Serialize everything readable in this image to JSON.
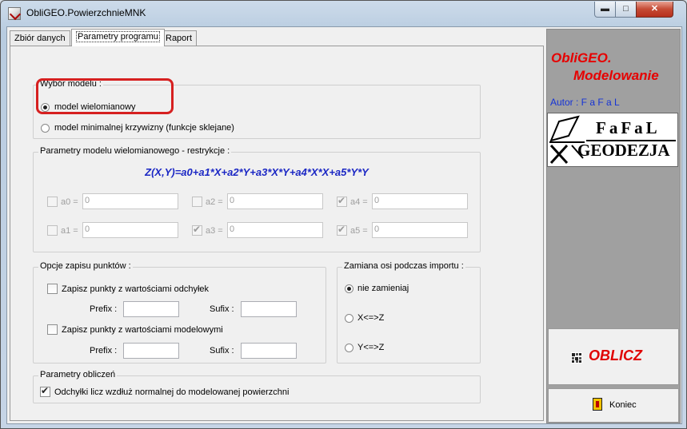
{
  "window": {
    "title": "ObliGEO.PowierzchnieMNK",
    "min_glyph": "▬",
    "max_glyph": "□",
    "close_glyph": "✕"
  },
  "tabs": [
    {
      "label": "Zbiór danych",
      "active": false
    },
    {
      "label": "Parametry programu",
      "active": true
    },
    {
      "label": "Raport",
      "active": false
    }
  ],
  "model_group": {
    "title": "Wybór modelu :",
    "options": [
      {
        "label": "model wielomianowy",
        "selected": true
      },
      {
        "label": "model minimalnej krzywizny (funkcje sklejane)",
        "selected": false
      }
    ]
  },
  "poly_group": {
    "title": "Parametry modelu wielomianowego - restrykcje :",
    "formula": "Z(X,Y)=a0+a1*X+a2*Y+a3*X*Y+a4*X*X+a5*Y*Y",
    "params": [
      {
        "label": "a0 =",
        "value": "0",
        "checked": false
      },
      {
        "label": "a2 =",
        "value": "0",
        "checked": false
      },
      {
        "label": "a4 =",
        "value": "0",
        "checked": true
      },
      {
        "label": "a1 =",
        "value": "0",
        "checked": false
      },
      {
        "label": "a3 =",
        "value": "0",
        "checked": true
      },
      {
        "label": "a5 =",
        "value": "0",
        "checked": true
      }
    ]
  },
  "save_group": {
    "title": "Opcje zapisu punktów :",
    "save_deviations": {
      "label": "Zapisz punkty z wartościami odchyłek",
      "checked": false
    },
    "save_model": {
      "label": "Zapisz punkty z wartościami modelowymi",
      "checked": false
    },
    "prefix_label": "Prefix :",
    "suffix_label": "Sufix :",
    "dev_prefix": "",
    "dev_suffix": "",
    "model_prefix": "",
    "model_suffix": ""
  },
  "axis_group": {
    "title": "Zamiana osi podczas importu :",
    "options": [
      {
        "label": "nie zamieniaj",
        "selected": true
      },
      {
        "label": "X<=>Z",
        "selected": false
      },
      {
        "label": "Y<=>Z",
        "selected": false
      }
    ]
  },
  "calc_group": {
    "title": "Parametry obliczeń",
    "normal_option": {
      "label": "Odchyłki licz wzdłuż normalnej do modelowanej powierzchni",
      "checked": true
    }
  },
  "right_panel": {
    "brand_line1": "ObliGEO.",
    "brand_line2": "Modelowanie",
    "author": "Autor : F a F a L",
    "logo_line1": "FaFaL",
    "logo_line2": "GEODEZJA",
    "calc_button": "OBLICZ",
    "end_button": "Koniec"
  },
  "colors": {
    "brand": "#e60000",
    "author": "#1533d6",
    "formula": "#1b27c4",
    "highlight": "#d62020"
  }
}
